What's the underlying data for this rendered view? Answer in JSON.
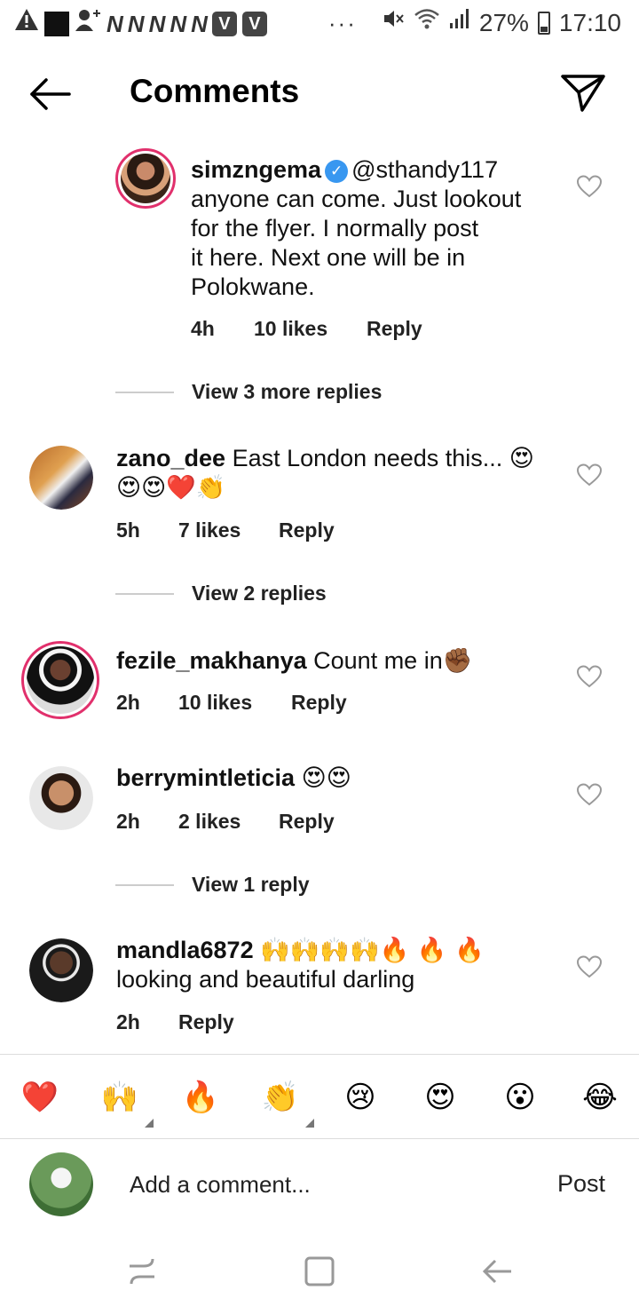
{
  "status_bar": {
    "n_icons": [
      "N",
      "N",
      "N",
      "N",
      "N"
    ],
    "v_icons": [
      "V",
      "V"
    ],
    "dots": "···",
    "battery": "27%",
    "time": "17:10"
  },
  "header": {
    "title": "Comments"
  },
  "comments": [
    {
      "username": "simzngema",
      "verified": true,
      "text": "@sthandy117 anyone can come. Just lookout for the flyer. I normally post it here. Next one will be in Polokwane.",
      "line1": "@sthandy117",
      "line2": "anyone can come. Just lookout",
      "line3": "for the flyer. I normally post",
      "line4": "it here. Next one will be in",
      "line5": "Polokwane.",
      "time": "4h",
      "likes": "10 likes",
      "reply": "Reply",
      "view_replies": "View 3 more replies"
    },
    {
      "username": "zano_dee",
      "text": "East London needs this...",
      "emojis_line1": "😍",
      "emojis_line2": "😍😍❤️👏",
      "time": "5h",
      "likes": "7 likes",
      "reply": "Reply",
      "view_replies": "View 2 replies"
    },
    {
      "username": "fezile_makhanya",
      "text": "Count me in",
      "emojis": "✊🏾",
      "time": "2h",
      "likes": "10 likes",
      "reply": "Reply"
    },
    {
      "username": "berrymintleticia",
      "emojis": "😍😍",
      "time": "2h",
      "likes": "2 likes",
      "reply": "Reply",
      "view_replies": "View 1 reply"
    },
    {
      "username": "mandla6872",
      "emojis": "🙌🙌🙌🙌🔥 🔥 🔥",
      "text": "looking and beautiful darling",
      "time": "2h",
      "reply": "Reply"
    }
  ],
  "emoji_bar": [
    "❤️",
    "🙌",
    "🔥",
    "👏",
    "😢",
    "😍",
    "😮",
    "😂"
  ],
  "composer": {
    "placeholder": "Add a comment...",
    "post_label": "Post"
  },
  "colors": {
    "verified": "#3897f0",
    "story_ring": "#e1306c"
  }
}
